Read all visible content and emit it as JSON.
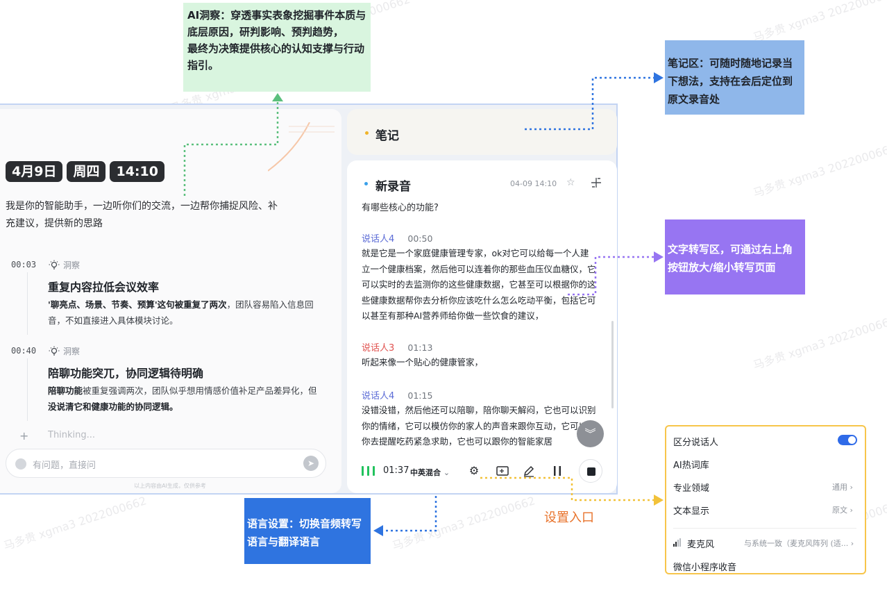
{
  "callouts": {
    "insight": "AI洞察：穿透事实表象挖掘事件本质与底层原因，研判影响、预判趋势，\n最终为决策提供核心的认知支撑与行动指引。",
    "notes": "笔记区：可随时随地记录当下想法，支持在会后定位到原文录音处",
    "transcribe": "文字转写区，可通过右上角按钮放大/缩小转写页面",
    "language": "语言设置：切换音频转写语言与翻译语言",
    "settings_entry": "设置入口"
  },
  "assistant": {
    "date": "4月9日",
    "weekday": "周四",
    "time": "14:10",
    "intro": "我是你的智能助手，一边听你们的交流，一边帮你捕捉风险、补充建议，提供新的思路",
    "insights": [
      {
        "time": "00:03",
        "tag": "洞察",
        "title": "重复内容拉低会议效率",
        "body_bold": "'聊亮点、场景、节奏、预算'这句被重复了两次",
        "body_rest": "，团队容易陷入信息回音，不如直接进入具体模块讨论。"
      },
      {
        "time": "00:40",
        "tag": "洞察",
        "title": "陪聊功能突兀，协同逻辑待明确",
        "body_bold": "陪聊功能",
        "body_mid": "被重复强调两次，团队似乎想用情感价值补足产品差异化，但",
        "body_bold2": "没说清它和健康功能的协同逻辑。"
      }
    ],
    "thinking": "Thinking...",
    "input_placeholder": "有问题，直接问",
    "disclaimer": "以上内容由AI生成，仅供参考"
  },
  "notes_panel": {
    "title": "笔记"
  },
  "recording": {
    "title": "新录音",
    "datetime": "04-09 14:10",
    "question": "有哪些核心的功能?",
    "segments": [
      {
        "speaker": "说话人4",
        "time": "00:50",
        "color": "#5b6bd6",
        "text": "就是它是一个家庭健康管理专家，ok对它可以给每一个人建立一个健康档案，然后他可以连着你的那些血压仪血糖仪，它可以实时的去监测你的这些健康数据，它甚至可以根据你的这些健康数据帮你去分析你应该吃什么怎么吃动平衡，包括它可以甚至有那种AI营养师给你做一些饮食的建议，"
      },
      {
        "speaker": "说话人3",
        "time": "01:13",
        "color": "#e0524f",
        "text": "听起来像一个贴心的健康管家，"
      },
      {
        "speaker": "说话人4",
        "time": "01:15",
        "color": "#5b6bd6",
        "text": "没错没错，然后他还可以陪聊，陪你聊天解闷，它也可以识别你的情绪，它可以模仿你的家人的声音来跟你互动，它可以帮你去提醒吃药紧急求助，它也可以跟你的智能家居"
      }
    ],
    "elapsed": "01:37",
    "language_mode": "中英混合"
  },
  "settings_menu": {
    "speaker_split": "区分说话人",
    "hotwords": "AI热词库",
    "domain": "专业领域",
    "domain_value": "通用",
    "text_display": "文本显示",
    "text_display_value": "原文",
    "microphone": "麦克风",
    "microphone_value": "与系统一致（麦克风阵列 (适...",
    "wechat": "微信小程序收音"
  },
  "watermark": "马多贵 xgma3 2022000662",
  "colors": {
    "insight_callout": "#d9f5df",
    "notes_callout": "#8fb7ea",
    "transcribe_callout": "#9775f2",
    "language_callout": "#2f74e0",
    "settings_border": "#f7c54a",
    "toggle_on": "#2f6be8",
    "recording_wave": "#21c25d"
  }
}
